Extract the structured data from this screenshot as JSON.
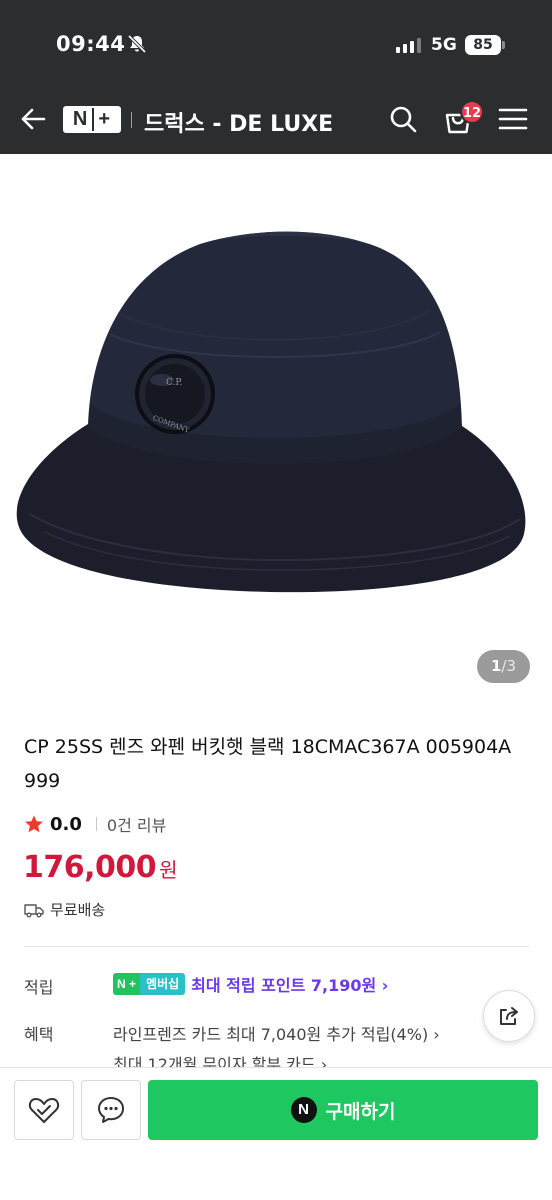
{
  "status_bar": {
    "time": "09:44",
    "network": "5G",
    "battery": "85"
  },
  "header": {
    "logo_n": "N",
    "logo_plus": "+",
    "store_name": "드럭스 - DE LUXE",
    "cart_count": "12"
  },
  "gallery": {
    "current": "1",
    "separator": "/",
    "total": "3"
  },
  "product": {
    "title": "CP 25SS 렌즈 와펜 버킷햇 블랙 18CMAC367A 005904A 999",
    "rating": "0.0",
    "reviews": "0건 리뷰",
    "price": "176,000",
    "price_unit": "원",
    "shipping": "무료배송"
  },
  "benefits": {
    "points_label": "적립",
    "badge_n": "N",
    "badge_plus": "+",
    "badge_member": "멤버십",
    "points_text": "최대 적립 포인트 7,190원 ›",
    "benefit_label": "혜택",
    "benefit_line1": "라인프렌즈 카드 최대 7,040원 추가 적립(4%) ›",
    "benefit_line2": "최대 12개월 무이자 할부 카드 ›"
  },
  "bottom_bar": {
    "buy_icon": "N",
    "buy_label": "구매하기"
  },
  "colors": {
    "header_bg": "#2b2d2f",
    "price": "#d1183c",
    "buy_button": "#1ec75f",
    "points_text": "#6a39ea",
    "badge": "#e8394d"
  }
}
